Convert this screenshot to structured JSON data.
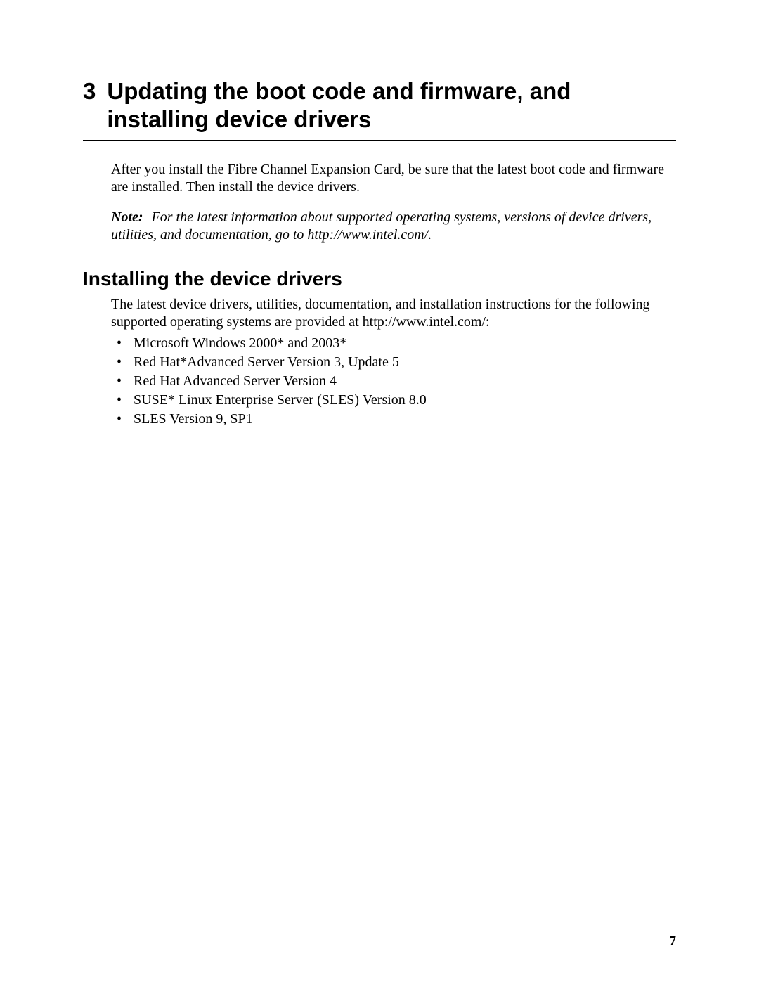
{
  "chapter": {
    "number": "3",
    "title": "Updating the boot code and firmware, and installing device drivers"
  },
  "intro_paragraph": "After you install the Fibre Channel Expansion Card, be sure that the latest boot code and firmware are installed. Then install the device drivers.",
  "note": {
    "label": "Note:",
    "text": "For the latest information about supported operating systems, versions of device drivers, utilities, and documentation, go to http://www.intel.com/."
  },
  "section": {
    "heading": "Installing the device drivers",
    "intro": "The latest device drivers, utilities, documentation, and installation instructions for the following supported operating systems are provided at http://www.intel.com/:",
    "items": [
      "Microsoft Windows 2000* and 2003*",
      "Red Hat*Advanced Server Version 3, Update 5",
      "Red Hat Advanced Server Version 4",
      "SUSE* Linux Enterprise Server (SLES) Version 8.0",
      "SLES Version 9, SP1"
    ]
  },
  "page_number": "7"
}
